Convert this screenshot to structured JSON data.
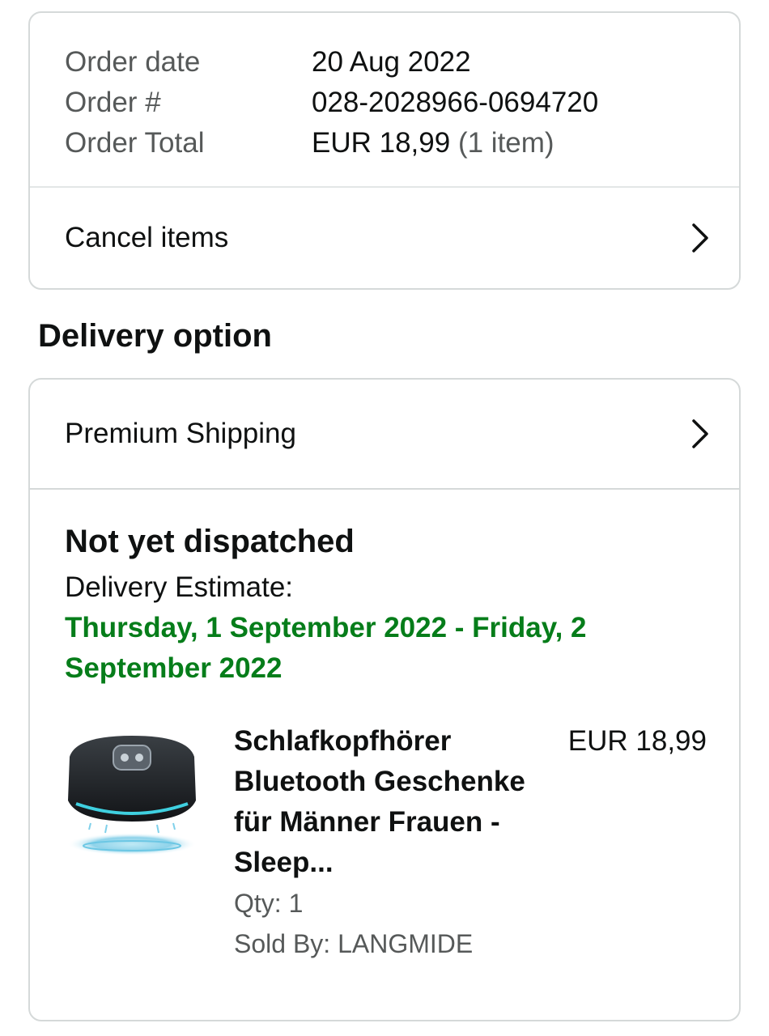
{
  "order_summary": {
    "rows": [
      {
        "label": "Order date",
        "value": "20 Aug 2022"
      },
      {
        "label": "Order #",
        "value": "028-2028966-0694720"
      },
      {
        "label": "Order Total",
        "value": "EUR 18,99",
        "suffix": "(1 item)"
      }
    ],
    "cancel_label": "Cancel items",
    "chevron_icon": "chevron-right-icon"
  },
  "delivery": {
    "section_title": "Delivery option",
    "option_label": "Premium Shipping",
    "chevron_icon": "chevron-right-icon"
  },
  "shipment": {
    "status": "Not yet dispatched",
    "estimate_label": "Delivery Estimate:",
    "estimate_date": "Thursday, 1 September 2022 - Friday, 2 September 2022",
    "estimate_color": "#067d1a",
    "item": {
      "title": "Schlafkopfhörer Bluetooth Geschenke für Männer Frauen - Sleep...",
      "price": "EUR 18,99",
      "qty": "Qty: 1",
      "sold_by": "Sold By: LANGMIDE",
      "image_icon": "sleep-headphones-product-image"
    }
  }
}
